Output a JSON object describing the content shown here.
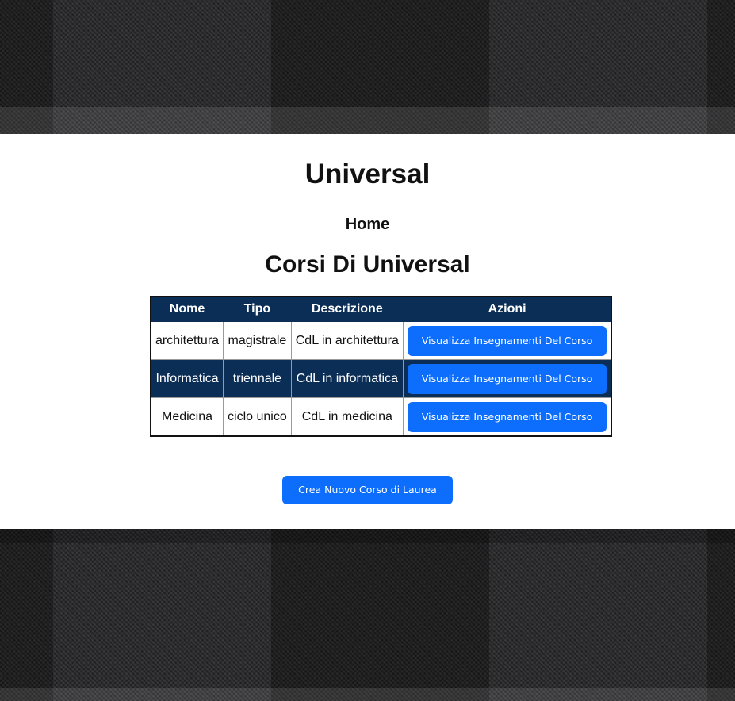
{
  "site": {
    "title": "Universal"
  },
  "nav": {
    "home_label": "Home"
  },
  "main": {
    "section_title": "Corsi Di Universal",
    "table": {
      "headers": [
        "Nome",
        "Tipo",
        "Descrizione",
        "Azioni"
      ],
      "rows": [
        {
          "nome": "architettura",
          "tipo": "magistrale",
          "descrizione": "CdL in architettura",
          "azione": "Visualizza Insegnamenti Del Corso"
        },
        {
          "nome": "Informatica",
          "tipo": "triennale",
          "descrizione": "CdL in informatica",
          "azione": "Visualizza Insegnamenti Del Corso"
        },
        {
          "nome": "Medicina",
          "tipo": "ciclo unico",
          "descrizione": "CdL in medicina",
          "azione": "Visualizza Insegnamenti Del Corso"
        }
      ]
    },
    "create_button_label": "Crea Nuovo Corso di Laurea"
  },
  "colors": {
    "accent": "#0d6efd",
    "header_navy": "#0b2e57",
    "banner": "#2a2a2c"
  }
}
